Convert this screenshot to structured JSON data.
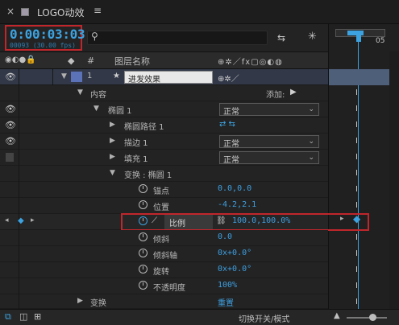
{
  "tab": {
    "close": "×",
    "title": "LOGO动效",
    "menu": "≡"
  },
  "time": {
    "timecode": "0:00:03:03",
    "fps": "00093 (30.00 fps)",
    "search_placeholder": ""
  },
  "timeline": {
    "marker": "05"
  },
  "columns": {
    "num": "#",
    "name": "图层名称"
  },
  "layer": {
    "index": "1",
    "name": "进发效果"
  },
  "rows": {
    "content": "内容",
    "add": "添加:",
    "ellipse": "椭圆 1",
    "ellipse_mode": "正常",
    "ellipse_path": "椭圆路径 1",
    "stroke": "描边 1",
    "stroke_mode": "正常",
    "fill": "填充 1",
    "fill_mode": "正常",
    "transform_ellipse": "变换 : 椭圆 1",
    "anchor": "锚点",
    "anchor_value": "0.0,0.0",
    "position": "位置",
    "position_value": "-4.2,2.1",
    "scale": "比例",
    "scale_value": "100.0,100.0%",
    "skew": "倾斜",
    "skew_value": "0.0",
    "skew_axis": "倾斜轴",
    "skew_axis_value": "0x+0.0°",
    "rotation": "旋转",
    "rotation_value": "0x+0.0°",
    "opacity": "不透明度",
    "opacity_value": "100%",
    "transform": "变换",
    "reset": "重置"
  },
  "bottom": {
    "toggle_label": "切换开关/模式"
  },
  "colors": {
    "accent": "#3ca2e0",
    "highlight": "#c0262b"
  }
}
